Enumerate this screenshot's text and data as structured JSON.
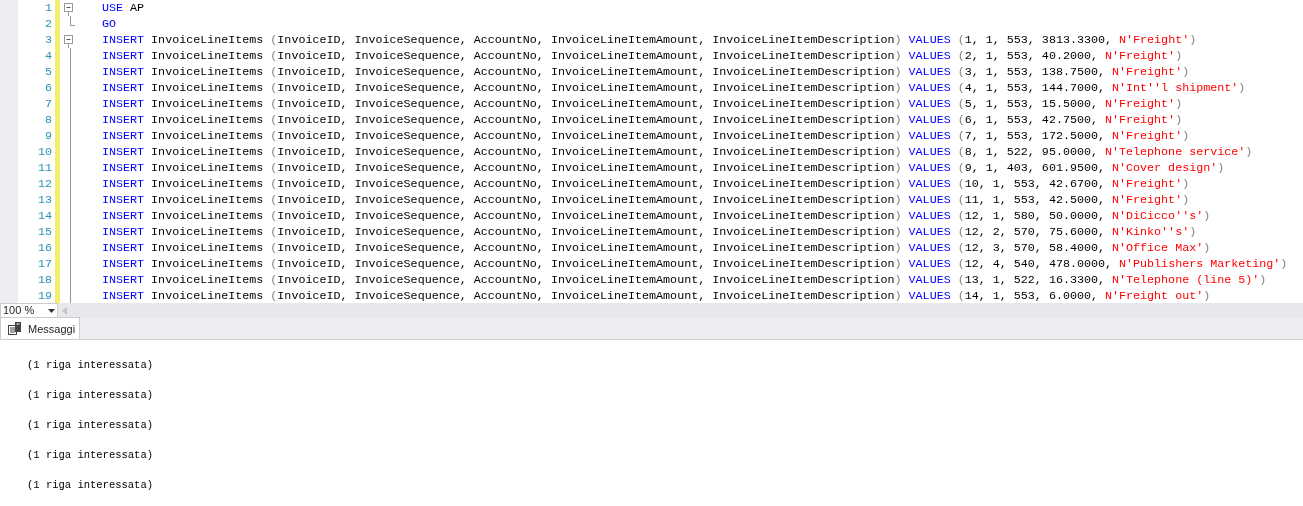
{
  "editor": {
    "lines": [
      {
        "number": "1",
        "kind": "start",
        "changed": true,
        "segments": [
          {
            "kind": "keyword",
            "text": "USE"
          },
          {
            "kind": "plain",
            "text": " AP"
          }
        ]
      },
      {
        "number": "2",
        "kind": "end",
        "changed": true,
        "segments": [
          {
            "kind": "keyword",
            "text": "GO"
          }
        ]
      },
      {
        "number": "3",
        "kind": "start",
        "changed": true,
        "segments": [
          {
            "kind": "keyword",
            "text": "INSERT"
          },
          {
            "kind": "plain",
            "text": " InvoiceLineItems "
          },
          {
            "kind": "punct",
            "text": "("
          },
          {
            "kind": "plain",
            "text": "InvoiceID, InvoiceSequence, AccountNo, InvoiceLineItemAmount, InvoiceLineItemDescription"
          },
          {
            "kind": "punct",
            "text": ") "
          },
          {
            "kind": "keyword",
            "text": "VALUES"
          },
          {
            "kind": "punct",
            "text": " ("
          },
          {
            "kind": "plain",
            "text": "1, 1, 553, 3813.3300, "
          },
          {
            "kind": "string",
            "text": "N'Freight'"
          },
          {
            "kind": "punct",
            "text": ")"
          }
        ]
      },
      {
        "number": "4",
        "kind": "inside",
        "changed": true,
        "segments": [
          {
            "kind": "keyword",
            "text": "INSERT"
          },
          {
            "kind": "plain",
            "text": " InvoiceLineItems "
          },
          {
            "kind": "punct",
            "text": "("
          },
          {
            "kind": "plain",
            "text": "InvoiceID, InvoiceSequence, AccountNo, InvoiceLineItemAmount, InvoiceLineItemDescription"
          },
          {
            "kind": "punct",
            "text": ") "
          },
          {
            "kind": "keyword",
            "text": "VALUES"
          },
          {
            "kind": "punct",
            "text": " ("
          },
          {
            "kind": "plain",
            "text": "2, 1, 553, 40.2000, "
          },
          {
            "kind": "string",
            "text": "N'Freight'"
          },
          {
            "kind": "punct",
            "text": ")"
          }
        ]
      },
      {
        "number": "5",
        "kind": "inside",
        "changed": true,
        "segments": [
          {
            "kind": "keyword",
            "text": "INSERT"
          },
          {
            "kind": "plain",
            "text": " InvoiceLineItems "
          },
          {
            "kind": "punct",
            "text": "("
          },
          {
            "kind": "plain",
            "text": "InvoiceID, InvoiceSequence, AccountNo, InvoiceLineItemAmount, InvoiceLineItemDescription"
          },
          {
            "kind": "punct",
            "text": ") "
          },
          {
            "kind": "keyword",
            "text": "VALUES"
          },
          {
            "kind": "punct",
            "text": " ("
          },
          {
            "kind": "plain",
            "text": "3, 1, 553, 138.7500, "
          },
          {
            "kind": "string",
            "text": "N'Freight'"
          },
          {
            "kind": "punct",
            "text": ")"
          }
        ]
      },
      {
        "number": "6",
        "kind": "inside",
        "changed": true,
        "segments": [
          {
            "kind": "keyword",
            "text": "INSERT"
          },
          {
            "kind": "plain",
            "text": " InvoiceLineItems "
          },
          {
            "kind": "punct",
            "text": "("
          },
          {
            "kind": "plain",
            "text": "InvoiceID, InvoiceSequence, AccountNo, InvoiceLineItemAmount, InvoiceLineItemDescription"
          },
          {
            "kind": "punct",
            "text": ") "
          },
          {
            "kind": "keyword",
            "text": "VALUES"
          },
          {
            "kind": "punct",
            "text": " ("
          },
          {
            "kind": "plain",
            "text": "4, 1, 553, 144.7000, "
          },
          {
            "kind": "string",
            "text": "N'Int''l shipment'"
          },
          {
            "kind": "punct",
            "text": ")"
          }
        ]
      },
      {
        "number": "7",
        "kind": "inside",
        "changed": true,
        "segments": [
          {
            "kind": "keyword",
            "text": "INSERT"
          },
          {
            "kind": "plain",
            "text": " InvoiceLineItems "
          },
          {
            "kind": "punct",
            "text": "("
          },
          {
            "kind": "plain",
            "text": "InvoiceID, InvoiceSequence, AccountNo, InvoiceLineItemAmount, InvoiceLineItemDescription"
          },
          {
            "kind": "punct",
            "text": ") "
          },
          {
            "kind": "keyword",
            "text": "VALUES"
          },
          {
            "kind": "punct",
            "text": " ("
          },
          {
            "kind": "plain",
            "text": "5, 1, 553, 15.5000, "
          },
          {
            "kind": "string",
            "text": "N'Freight'"
          },
          {
            "kind": "punct",
            "text": ")"
          }
        ]
      },
      {
        "number": "8",
        "kind": "inside",
        "changed": true,
        "segments": [
          {
            "kind": "keyword",
            "text": "INSERT"
          },
          {
            "kind": "plain",
            "text": " InvoiceLineItems "
          },
          {
            "kind": "punct",
            "text": "("
          },
          {
            "kind": "plain",
            "text": "InvoiceID, InvoiceSequence, AccountNo, InvoiceLineItemAmount, InvoiceLineItemDescription"
          },
          {
            "kind": "punct",
            "text": ") "
          },
          {
            "kind": "keyword",
            "text": "VALUES"
          },
          {
            "kind": "punct",
            "text": " ("
          },
          {
            "kind": "plain",
            "text": "6, 1, 553, 42.7500, "
          },
          {
            "kind": "string",
            "text": "N'Freight'"
          },
          {
            "kind": "punct",
            "text": ")"
          }
        ]
      },
      {
        "number": "9",
        "kind": "inside",
        "changed": true,
        "segments": [
          {
            "kind": "keyword",
            "text": "INSERT"
          },
          {
            "kind": "plain",
            "text": " InvoiceLineItems "
          },
          {
            "kind": "punct",
            "text": "("
          },
          {
            "kind": "plain",
            "text": "InvoiceID, InvoiceSequence, AccountNo, InvoiceLineItemAmount, InvoiceLineItemDescription"
          },
          {
            "kind": "punct",
            "text": ") "
          },
          {
            "kind": "keyword",
            "text": "VALUES"
          },
          {
            "kind": "punct",
            "text": " ("
          },
          {
            "kind": "plain",
            "text": "7, 1, 553, 172.5000, "
          },
          {
            "kind": "string",
            "text": "N'Freight'"
          },
          {
            "kind": "punct",
            "text": ")"
          }
        ]
      },
      {
        "number": "10",
        "kind": "inside",
        "changed": true,
        "segments": [
          {
            "kind": "keyword",
            "text": "INSERT"
          },
          {
            "kind": "plain",
            "text": " InvoiceLineItems "
          },
          {
            "kind": "punct",
            "text": "("
          },
          {
            "kind": "plain",
            "text": "InvoiceID, InvoiceSequence, AccountNo, InvoiceLineItemAmount, InvoiceLineItemDescription"
          },
          {
            "kind": "punct",
            "text": ") "
          },
          {
            "kind": "keyword",
            "text": "VALUES"
          },
          {
            "kind": "punct",
            "text": " ("
          },
          {
            "kind": "plain",
            "text": "8, 1, 522, 95.0000, "
          },
          {
            "kind": "string",
            "text": "N'Telephone service'"
          },
          {
            "kind": "punct",
            "text": ")"
          }
        ]
      },
      {
        "number": "11",
        "kind": "inside",
        "changed": true,
        "segments": [
          {
            "kind": "keyword",
            "text": "INSERT"
          },
          {
            "kind": "plain",
            "text": " InvoiceLineItems "
          },
          {
            "kind": "punct",
            "text": "("
          },
          {
            "kind": "plain",
            "text": "InvoiceID, InvoiceSequence, AccountNo, InvoiceLineItemAmount, InvoiceLineItemDescription"
          },
          {
            "kind": "punct",
            "text": ") "
          },
          {
            "kind": "keyword",
            "text": "VALUES"
          },
          {
            "kind": "punct",
            "text": " ("
          },
          {
            "kind": "plain",
            "text": "9, 1, 403, 601.9500, "
          },
          {
            "kind": "string",
            "text": "N'Cover design'"
          },
          {
            "kind": "punct",
            "text": ")"
          }
        ]
      },
      {
        "number": "12",
        "kind": "inside",
        "changed": true,
        "segments": [
          {
            "kind": "keyword",
            "text": "INSERT"
          },
          {
            "kind": "plain",
            "text": " InvoiceLineItems "
          },
          {
            "kind": "punct",
            "text": "("
          },
          {
            "kind": "plain",
            "text": "InvoiceID, InvoiceSequence, AccountNo, InvoiceLineItemAmount, InvoiceLineItemDescription"
          },
          {
            "kind": "punct",
            "text": ") "
          },
          {
            "kind": "keyword",
            "text": "VALUES"
          },
          {
            "kind": "punct",
            "text": " ("
          },
          {
            "kind": "plain",
            "text": "10, 1, 553, 42.6700, "
          },
          {
            "kind": "string",
            "text": "N'Freight'"
          },
          {
            "kind": "punct",
            "text": ")"
          }
        ]
      },
      {
        "number": "13",
        "kind": "inside",
        "changed": true,
        "segments": [
          {
            "kind": "keyword",
            "text": "INSERT"
          },
          {
            "kind": "plain",
            "text": " InvoiceLineItems "
          },
          {
            "kind": "punct",
            "text": "("
          },
          {
            "kind": "plain",
            "text": "InvoiceID, InvoiceSequence, AccountNo, InvoiceLineItemAmount, InvoiceLineItemDescription"
          },
          {
            "kind": "punct",
            "text": ") "
          },
          {
            "kind": "keyword",
            "text": "VALUES"
          },
          {
            "kind": "punct",
            "text": " ("
          },
          {
            "kind": "plain",
            "text": "11, 1, 553, 42.5000, "
          },
          {
            "kind": "string",
            "text": "N'Freight'"
          },
          {
            "kind": "punct",
            "text": ")"
          }
        ]
      },
      {
        "number": "14",
        "kind": "inside",
        "changed": true,
        "segments": [
          {
            "kind": "keyword",
            "text": "INSERT"
          },
          {
            "kind": "plain",
            "text": " InvoiceLineItems "
          },
          {
            "kind": "punct",
            "text": "("
          },
          {
            "kind": "plain",
            "text": "InvoiceID, InvoiceSequence, AccountNo, InvoiceLineItemAmount, InvoiceLineItemDescription"
          },
          {
            "kind": "punct",
            "text": ") "
          },
          {
            "kind": "keyword",
            "text": "VALUES"
          },
          {
            "kind": "punct",
            "text": " ("
          },
          {
            "kind": "plain",
            "text": "12, 1, 580, 50.0000, "
          },
          {
            "kind": "string",
            "text": "N'DiCicco''s'"
          },
          {
            "kind": "punct",
            "text": ")"
          }
        ]
      },
      {
        "number": "15",
        "kind": "inside",
        "changed": true,
        "segments": [
          {
            "kind": "keyword",
            "text": "INSERT"
          },
          {
            "kind": "plain",
            "text": " InvoiceLineItems "
          },
          {
            "kind": "punct",
            "text": "("
          },
          {
            "kind": "plain",
            "text": "InvoiceID, InvoiceSequence, AccountNo, InvoiceLineItemAmount, InvoiceLineItemDescription"
          },
          {
            "kind": "punct",
            "text": ") "
          },
          {
            "kind": "keyword",
            "text": "VALUES"
          },
          {
            "kind": "punct",
            "text": " ("
          },
          {
            "kind": "plain",
            "text": "12, 2, 570, 75.6000, "
          },
          {
            "kind": "string",
            "text": "N'Kinko''s'"
          },
          {
            "kind": "punct",
            "text": ")"
          }
        ]
      },
      {
        "number": "16",
        "kind": "inside",
        "changed": true,
        "segments": [
          {
            "kind": "keyword",
            "text": "INSERT"
          },
          {
            "kind": "plain",
            "text": " InvoiceLineItems "
          },
          {
            "kind": "punct",
            "text": "("
          },
          {
            "kind": "plain",
            "text": "InvoiceID, InvoiceSequence, AccountNo, InvoiceLineItemAmount, InvoiceLineItemDescription"
          },
          {
            "kind": "punct",
            "text": ") "
          },
          {
            "kind": "keyword",
            "text": "VALUES"
          },
          {
            "kind": "punct",
            "text": " ("
          },
          {
            "kind": "plain",
            "text": "12, 3, 570, 58.4000, "
          },
          {
            "kind": "string",
            "text": "N'Office Max'"
          },
          {
            "kind": "punct",
            "text": ")"
          }
        ]
      },
      {
        "number": "17",
        "kind": "inside",
        "changed": true,
        "segments": [
          {
            "kind": "keyword",
            "text": "INSERT"
          },
          {
            "kind": "plain",
            "text": " InvoiceLineItems "
          },
          {
            "kind": "punct",
            "text": "("
          },
          {
            "kind": "plain",
            "text": "InvoiceID, InvoiceSequence, AccountNo, InvoiceLineItemAmount, InvoiceLineItemDescription"
          },
          {
            "kind": "punct",
            "text": ") "
          },
          {
            "kind": "keyword",
            "text": "VALUES"
          },
          {
            "kind": "punct",
            "text": " ("
          },
          {
            "kind": "plain",
            "text": "12, 4, 540, 478.0000, "
          },
          {
            "kind": "string",
            "text": "N'Publishers Marketing'"
          },
          {
            "kind": "punct",
            "text": ")"
          }
        ]
      },
      {
        "number": "18",
        "kind": "inside",
        "changed": true,
        "segments": [
          {
            "kind": "keyword",
            "text": "INSERT"
          },
          {
            "kind": "plain",
            "text": " InvoiceLineItems "
          },
          {
            "kind": "punct",
            "text": "("
          },
          {
            "kind": "plain",
            "text": "InvoiceID, InvoiceSequence, AccountNo, InvoiceLineItemAmount, InvoiceLineItemDescription"
          },
          {
            "kind": "punct",
            "text": ") "
          },
          {
            "kind": "keyword",
            "text": "VALUES"
          },
          {
            "kind": "punct",
            "text": " ("
          },
          {
            "kind": "plain",
            "text": "13, 1, 522, 16.3300, "
          },
          {
            "kind": "string",
            "text": "N'Telephone (line 5)'"
          },
          {
            "kind": "punct",
            "text": ")"
          }
        ]
      },
      {
        "number": "19",
        "kind": "inside",
        "changed": true,
        "segments": [
          {
            "kind": "keyword",
            "text": "INSERT"
          },
          {
            "kind": "plain",
            "text": " InvoiceLineItems "
          },
          {
            "kind": "punct",
            "text": "("
          },
          {
            "kind": "plain",
            "text": "InvoiceID, InvoiceSequence, AccountNo, InvoiceLineItemAmount, InvoiceLineItemDescription"
          },
          {
            "kind": "punct",
            "text": ") "
          },
          {
            "kind": "keyword",
            "text": "VALUES"
          },
          {
            "kind": "punct",
            "text": " ("
          },
          {
            "kind": "plain",
            "text": "14, 1, 553, 6.0000, "
          },
          {
            "kind": "string",
            "text": "N'Freight out'"
          },
          {
            "kind": "punct",
            "text": ")"
          }
        ]
      }
    ]
  },
  "zoom": {
    "value": "100 %"
  },
  "tabs": [
    {
      "label": "Messaggi",
      "selected": true
    }
  ],
  "messages": [
    "(1 riga interessata)",
    "(1 riga interessata)",
    "(1 riga interessata)",
    "(1 riga interessata)",
    "(1 riga interessata)"
  ]
}
